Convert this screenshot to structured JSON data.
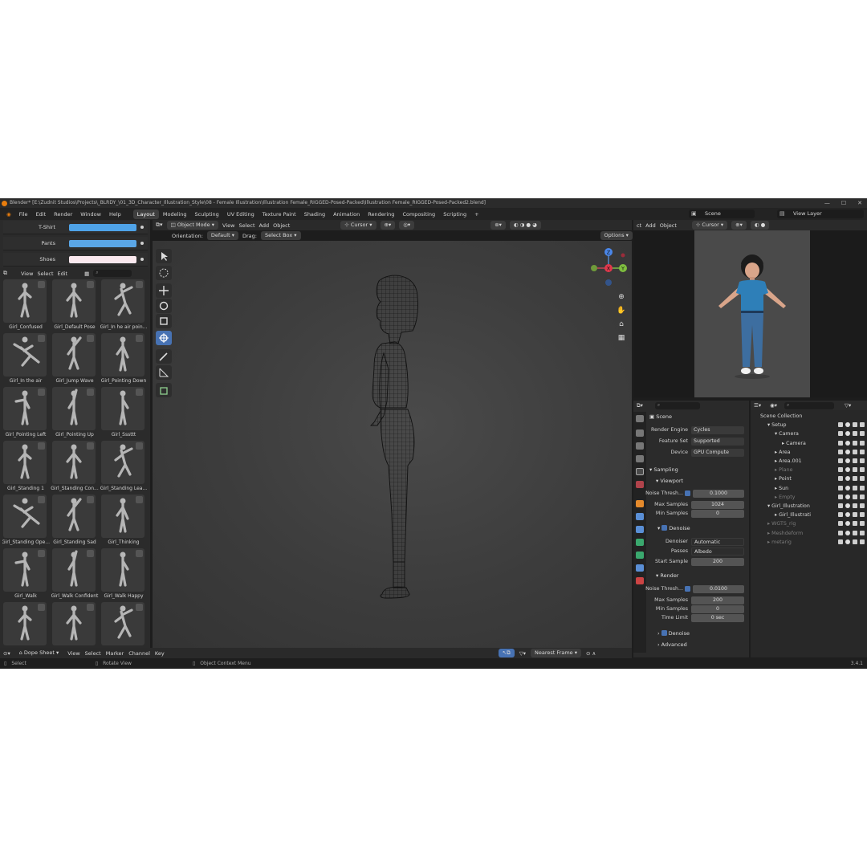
{
  "titlebar": {
    "text": "Blender* [E:\\Zudnit Studios\\Projects\\_BLRDY_\\01_3D_Character_Illustration_Style\\08 - Female Illustration\\Illustration Female_RIGGED-Posed-Packed\\Illustration Female_RIGGED-Posed-Packed2.blend]"
  },
  "menu": [
    "File",
    "Edit",
    "Render",
    "Window",
    "Help"
  ],
  "workspaces": [
    "Layout",
    "Modeling",
    "Sculpting",
    "UV Editing",
    "Texture Paint",
    "Shading",
    "Animation",
    "Rendering",
    "Compositing",
    "Scripting"
  ],
  "active_workspace": "Layout",
  "scene_field": "Scene",
  "view_layer_field": "View Layer",
  "colors": [
    {
      "label": "T-Shirt",
      "hex": "#4fa3e8"
    },
    {
      "label": "Pants",
      "hex": "#5aa6e6"
    },
    {
      "label": "Shoes",
      "hex": "#fbe9ef"
    }
  ],
  "asset_header": {
    "view": "View",
    "select": "Select",
    "edit": "Edit"
  },
  "assets": [
    "Girl_Confused",
    "Girl_Default Pose",
    "Girl_In he air poin...",
    "Girl_In the air",
    "Girl_Jump Wave",
    "Girl_Pointing Down",
    "Girl_Pointing Left",
    "Girl_Pointing Up",
    "Girl_Sssttt",
    "Girl_Standing 1",
    "Girl_Standing Con...",
    "Girl_Standing Lea...",
    "Girl_Standing Ope...",
    "Girl_Standing Sad",
    "Girl_Thinking",
    "Girl_Walk",
    "Girl_Walk Confident",
    "Girl_Walk Happy",
    "",
    "",
    ""
  ],
  "viewport_header": {
    "mode": "Object Mode",
    "view": "View",
    "select": "Select",
    "add": "Add",
    "object": "Object",
    "pivot": "Cursor",
    "orientation_label": "Orientation:",
    "orientation_value": "Default",
    "drag_label": "Drag:",
    "drag_value": "Select Box",
    "options": "Options"
  },
  "gizmo": {
    "z": "Z",
    "x": "X",
    "y": "Y"
  },
  "render_view_header": {
    "ct": "ct",
    "add": "Add",
    "object": "Object",
    "pivot": "Cursor"
  },
  "properties": {
    "context": "Scene",
    "render_engine_label": "Render Engine",
    "render_engine": "Cycles",
    "feature_set_label": "Feature Set",
    "feature_set": "Supported",
    "device_label": "Device",
    "device": "GPU Compute",
    "sampling": "Sampling",
    "viewport": "Viewport",
    "vp_noise_label": "Noise Thresh...",
    "vp_noise": "0.1000",
    "vp_max_label": "Max Samples",
    "vp_max": "1024",
    "vp_min_label": "Min Samples",
    "vp_min": "0",
    "denoise": "Denoise",
    "denoiser_label": "Denoiser",
    "denoiser": "Automatic",
    "passes_label": "Passes",
    "passes": "Albedo",
    "start_sample_label": "Start Sample",
    "start_sample": "200",
    "render": "Render",
    "r_noise_label": "Noise Thresh...",
    "r_noise": "0.0100",
    "r_max_label": "Max Samples",
    "r_max": "200",
    "r_min_label": "Min Samples",
    "r_min": "0",
    "time_limit_label": "Time Limit",
    "time_limit": "0 sec",
    "denoise2": "Denoise",
    "advanced": "Advanced"
  },
  "outliner": [
    {
      "name": "Scene Collection",
      "depth": 0,
      "dim": false
    },
    {
      "name": "Setup",
      "depth": 1,
      "dim": false
    },
    {
      "name": "Camera",
      "depth": 2,
      "dim": false
    },
    {
      "name": "Camera",
      "depth": 3,
      "dim": false
    },
    {
      "name": "Area",
      "depth": 2,
      "dim": false
    },
    {
      "name": "Area.001",
      "depth": 2,
      "dim": false
    },
    {
      "name": "Plane",
      "depth": 2,
      "dim": true
    },
    {
      "name": "Point",
      "depth": 2,
      "dim": false
    },
    {
      "name": "Sun",
      "depth": 2,
      "dim": false
    },
    {
      "name": "Empty",
      "depth": 2,
      "dim": true
    },
    {
      "name": "Girl_Illustration",
      "depth": 1,
      "dim": false
    },
    {
      "name": "Girl_Illustrati",
      "depth": 2,
      "dim": false
    },
    {
      "name": "WGTS_rig",
      "depth": 1,
      "dim": true
    },
    {
      "name": "Meshdeform",
      "depth": 1,
      "dim": true
    },
    {
      "name": "metarig",
      "depth": 1,
      "dim": true
    }
  ],
  "bottom_header": {
    "editor": "Dope Sheet",
    "view": "View",
    "select": "Select",
    "marker": "Marker",
    "channel": "Channel",
    "key": "Key",
    "snap": "Nearest Frame"
  },
  "status": {
    "select": "Select",
    "rotate": "Rotate View",
    "context": "Object Context Menu",
    "version": "3.4.1"
  }
}
